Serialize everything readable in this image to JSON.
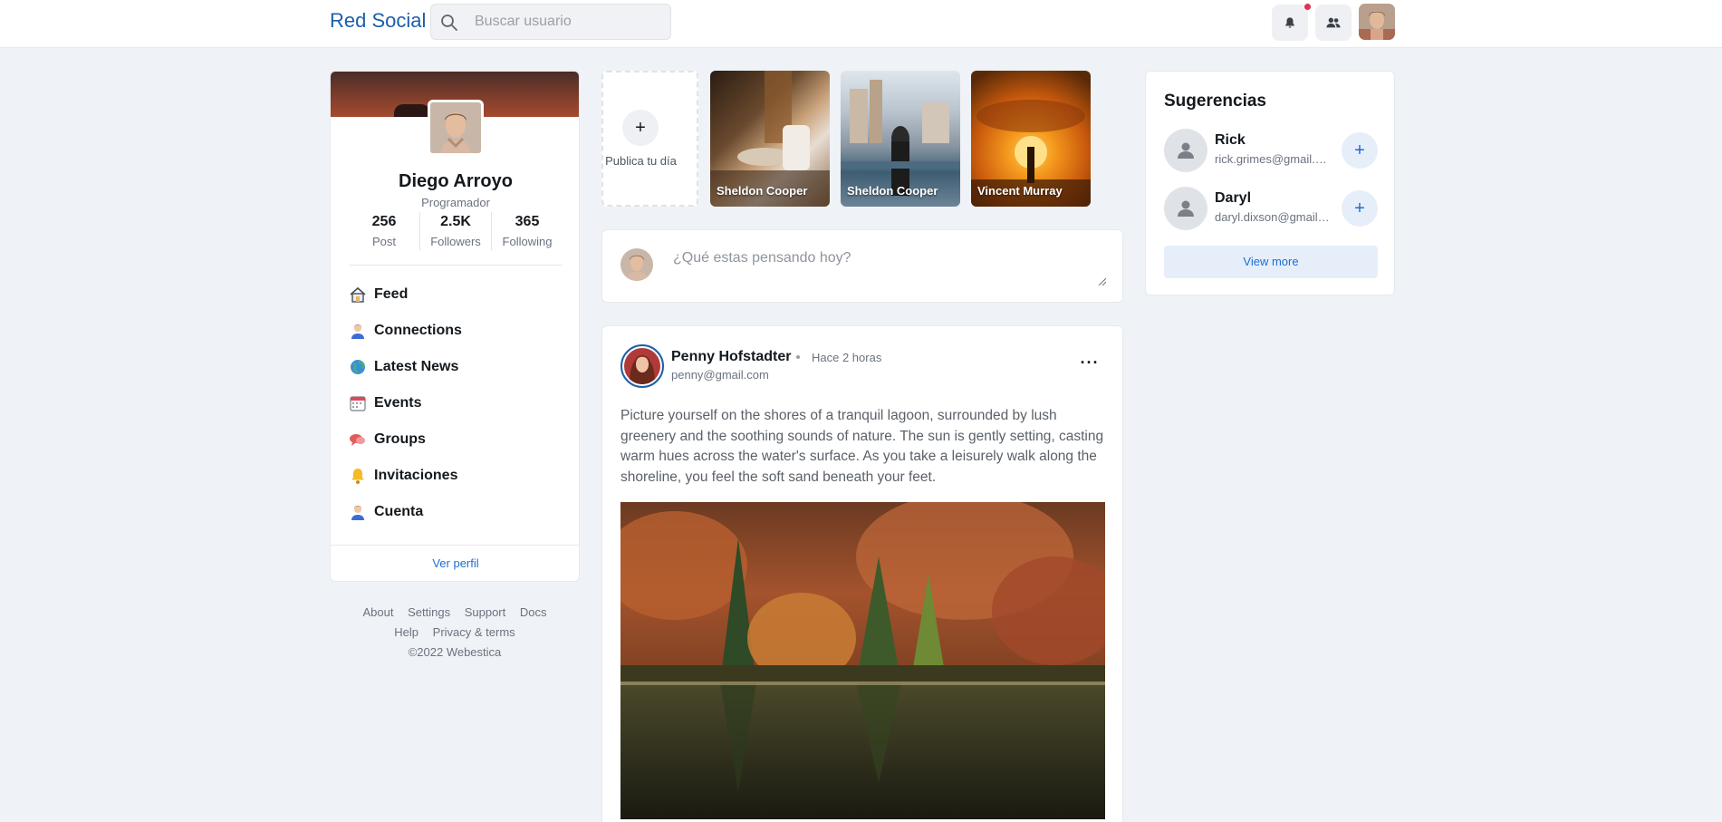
{
  "header": {
    "brand": "Red Social",
    "search_placeholder": "Buscar usuario"
  },
  "profile": {
    "name": "Diego Arroyo",
    "role": "Programador",
    "stats": [
      {
        "value": "256",
        "label": "Post"
      },
      {
        "value": "2.5K",
        "label": "Followers"
      },
      {
        "value": "365",
        "label": "Following"
      }
    ],
    "nav": [
      {
        "label": "Feed",
        "icon": "house-icon"
      },
      {
        "label": "Connections",
        "icon": "person-icon"
      },
      {
        "label": "Latest News",
        "icon": "globe-icon"
      },
      {
        "label": "Events",
        "icon": "calendar-icon"
      },
      {
        "label": "Groups",
        "icon": "chat-bubbles-icon"
      },
      {
        "label": "Invitaciones",
        "icon": "bell-icon"
      },
      {
        "label": "Cuenta",
        "icon": "person-icon"
      }
    ],
    "view_profile": "Ver perfil"
  },
  "footer": {
    "links": [
      "About",
      "Settings",
      "Support",
      "Docs",
      "Help",
      "Privacy & terms"
    ],
    "copyright": "©2022 Webestica"
  },
  "stories": {
    "add_label": "Publica tu día",
    "add_symbol": "+",
    "items": [
      {
        "name": "Sheldon Cooper"
      },
      {
        "name": "Sheldon Cooper"
      },
      {
        "name": "Vincent Murray"
      }
    ]
  },
  "composer": {
    "placeholder": "¿Qué estas pensando hoy?"
  },
  "post": {
    "author": "Penny Hofstadter",
    "time": "Hace 2 horas",
    "email": "penny@gmail.com",
    "more": "···",
    "text": "Picture yourself on the shores of a tranquil lagoon, surrounded by lush greenery and the soothing sounds of nature. The sun is gently setting, casting warm hues across the water's surface. As you take a leisurely walk along the shoreline, you feel the soft sand beneath your feet."
  },
  "suggestions": {
    "title": "Sugerencias",
    "add_symbol": "+",
    "items": [
      {
        "name": "Rick",
        "email": "rick.grimes@gmail.com"
      },
      {
        "name": "Daryl",
        "email": "daryl.dixson@gmail.com"
      }
    ],
    "view_more": "View more"
  },
  "colors": {
    "brand": "#1c5fa8",
    "accent": "#1c6fd1",
    "notification": "#e0314d",
    "background": "#eff2f6"
  }
}
